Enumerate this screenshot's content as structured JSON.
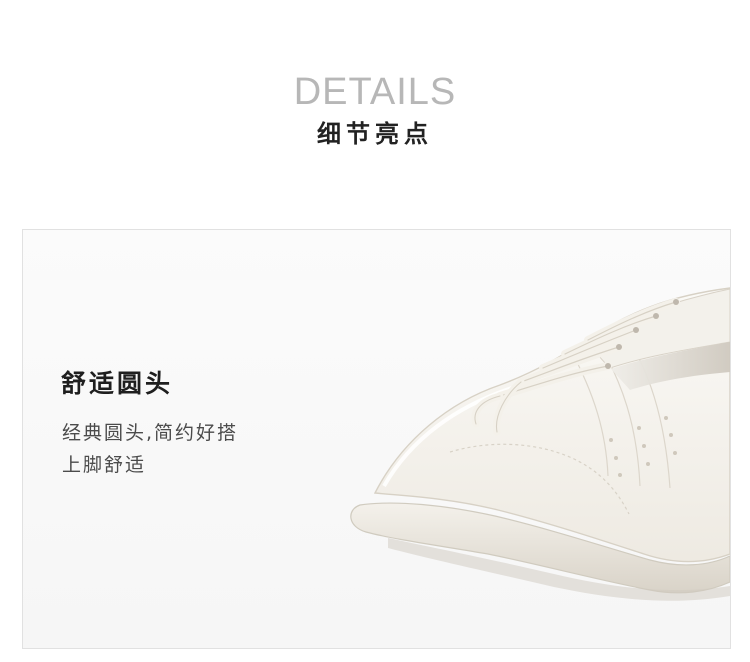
{
  "header": {
    "title_en": "DETAILS",
    "title_cn": "细节亮点"
  },
  "feature": {
    "title": "舒适圆头",
    "description_lines": [
      "经典圆头,简约好搭",
      "上脚舒适"
    ]
  },
  "colors": {
    "background": "#ffffff",
    "panel_background": "#f7f7f7",
    "panel_border": "#e1e1e1",
    "title_en": "#b7b7b7",
    "title_cn": "#222222",
    "feature_title": "#1f1f1f",
    "feature_text": "#4b4b4b",
    "shoe_upper": "#f5f3ee",
    "shoe_sole": "#ece8df",
    "shoe_shadow": "#d8d3c7"
  }
}
